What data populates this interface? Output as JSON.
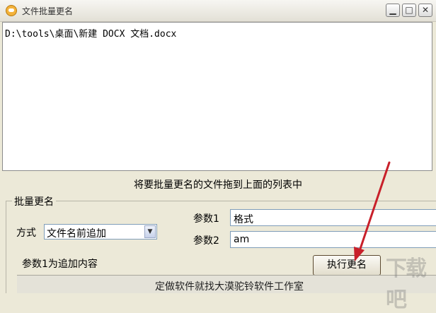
{
  "window": {
    "title": "文件批量更名",
    "minimize_glyph": "▁",
    "maximize_glyph": "□",
    "close_glyph": "✕"
  },
  "file_list": {
    "items": [
      "D:\\tools\\桌面\\新建 DOCX 文档.docx"
    ]
  },
  "hint": "将要批量更名的文件拖到上面的列表中",
  "rename_group": {
    "title": "批量更名",
    "mode_label": "方式",
    "mode_selected": "文件名前追加",
    "param1_label": "参数1",
    "param1_value": "格式",
    "param2_label": "参数2",
    "param2_value": "am",
    "note": "参数1为追加内容",
    "run_button": "执行更名"
  },
  "footer": "定做软件就找大漠驼铃软件工作室",
  "watermark": "下载吧",
  "colors": {
    "arrow": "#c8202a",
    "window_bg": "#ece9d8"
  }
}
